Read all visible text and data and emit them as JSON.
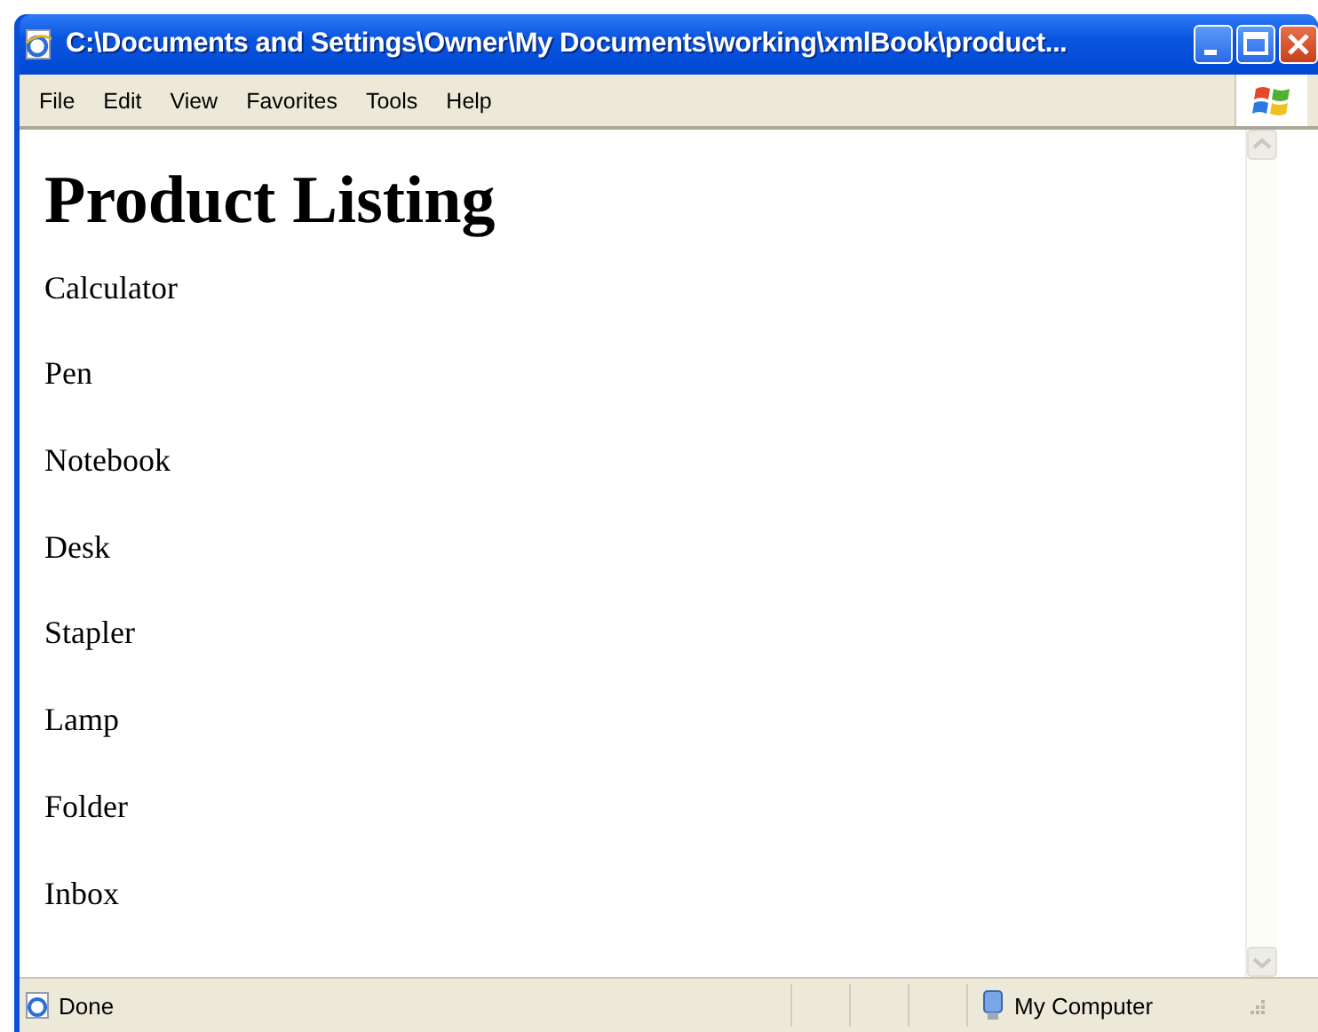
{
  "window": {
    "title": "C:\\Documents and Settings\\Owner\\My Documents\\working\\xmlBook\\product..."
  },
  "menu": [
    "File",
    "Edit",
    "View",
    "Favorites",
    "Tools",
    "Help"
  ],
  "document": {
    "heading": "Product Listing",
    "items": [
      "Calculator",
      "Pen",
      "Notebook",
      "Desk",
      "Stapler",
      "Lamp",
      "Folder",
      "Inbox"
    ]
  },
  "status_bar": {
    "text": "Done",
    "zone": "My Computer"
  }
}
